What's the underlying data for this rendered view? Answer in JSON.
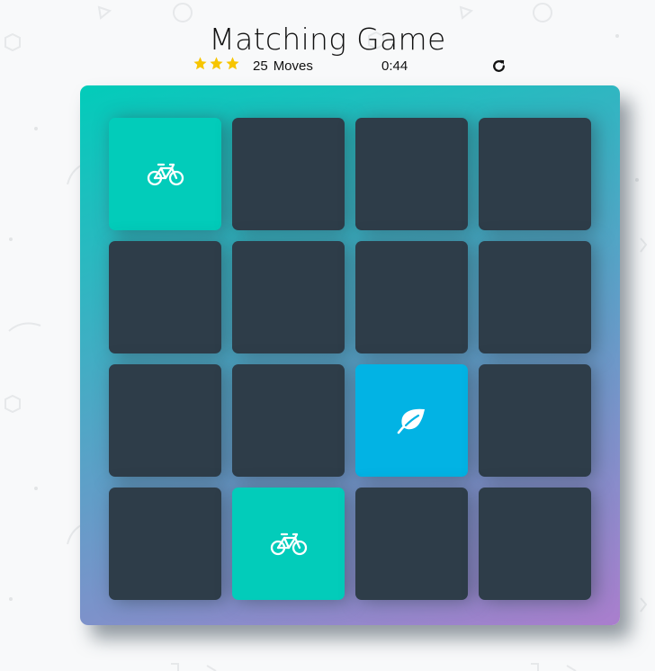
{
  "game": {
    "title": "Matching Game",
    "stars": 3,
    "moves_count": "25",
    "moves_label": "Moves",
    "timer": "0:44"
  },
  "colors": {
    "card_closed": "#2e3d49",
    "card_match": "#02ccba",
    "card_open": "#02b3e4",
    "star": "#f7c500",
    "gradient_start": "#02ccba",
    "gradient_end": "#aa7ecd"
  },
  "cards": [
    {
      "state": "match",
      "icon": "bicycle-icon"
    },
    {
      "state": "closed",
      "icon": ""
    },
    {
      "state": "closed",
      "icon": ""
    },
    {
      "state": "closed",
      "icon": ""
    },
    {
      "state": "closed",
      "icon": ""
    },
    {
      "state": "closed",
      "icon": ""
    },
    {
      "state": "closed",
      "icon": ""
    },
    {
      "state": "closed",
      "icon": ""
    },
    {
      "state": "closed",
      "icon": ""
    },
    {
      "state": "closed",
      "icon": ""
    },
    {
      "state": "open",
      "icon": "leaf-icon"
    },
    {
      "state": "closed",
      "icon": ""
    },
    {
      "state": "closed",
      "icon": ""
    },
    {
      "state": "match",
      "icon": "bicycle-icon"
    },
    {
      "state": "closed",
      "icon": ""
    },
    {
      "state": "closed",
      "icon": ""
    }
  ]
}
